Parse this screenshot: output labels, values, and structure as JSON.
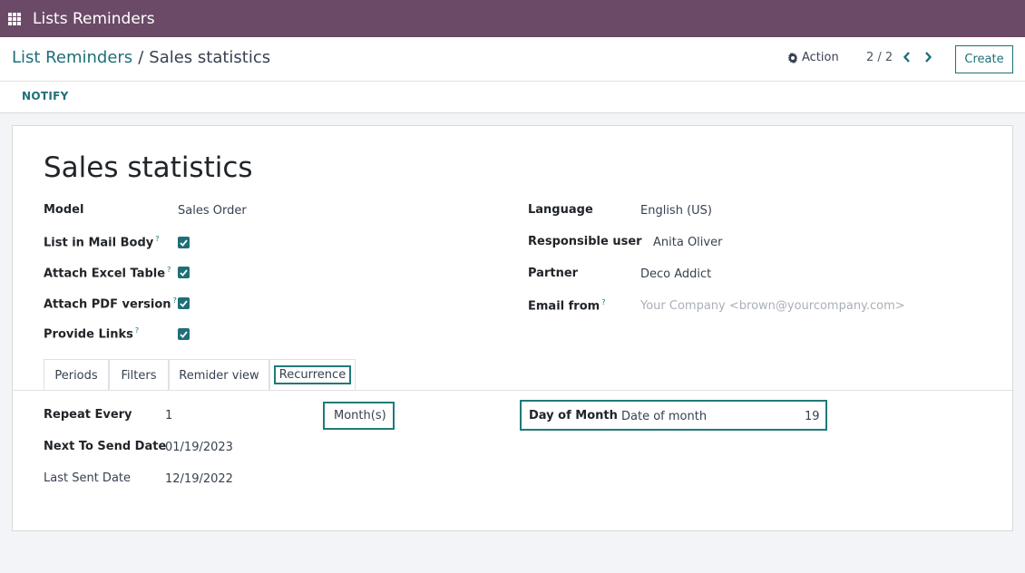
{
  "topbar": {
    "app_title": "Lists Reminders",
    "apps_icon": "grid-icon"
  },
  "breadcrumb": {
    "parent": "List Reminders",
    "separator": "/",
    "current": "Sales statistics"
  },
  "controls": {
    "action_label": "Action",
    "pager": "2 / 2",
    "create_label": "Create"
  },
  "statusbar": {
    "notify_label": "NOTIFY"
  },
  "record": {
    "title": "Sales statistics",
    "left_fields": {
      "model_label": "Model",
      "model_value": "Sales Order",
      "list_in_mail_body_label": "List in Mail Body",
      "attach_excel_label": "Attach Excel Table",
      "attach_pdf_label": "Attach PDF version",
      "provide_links_label": "Provide Links",
      "help_mark": "?"
    },
    "right_fields": {
      "language_label": "Language",
      "language_value": "English (US)",
      "responsible_label": "Responsible user",
      "responsible_value": "Anita Oliver",
      "partner_label": "Partner",
      "partner_value": "Deco Addict",
      "email_from_label": "Email from",
      "email_from_placeholder": "Your Company <brown@yourcompany.com>"
    },
    "checkboxes": {
      "list_in_mail_body": true,
      "attach_excel": true,
      "attach_pdf": true,
      "provide_links": true
    }
  },
  "tabs": [
    "Periods",
    "Filters",
    "Remider view",
    "Recurrence"
  ],
  "recurrence": {
    "repeat_every_label": "Repeat Every",
    "repeat_every_value": "1",
    "repeat_unit": "Month(s)",
    "next_send_label": "Next To Send Date",
    "next_send_value": "01/19/2023",
    "last_sent_label": "Last Sent Date",
    "last_sent_value": "12/19/2022",
    "day_of_month_label": "Day of Month",
    "day_of_month_type": "Date of month",
    "day_of_month_value": "19"
  },
  "colors": {
    "topbar": "#6b4a68",
    "accent": "#1f6f78"
  }
}
